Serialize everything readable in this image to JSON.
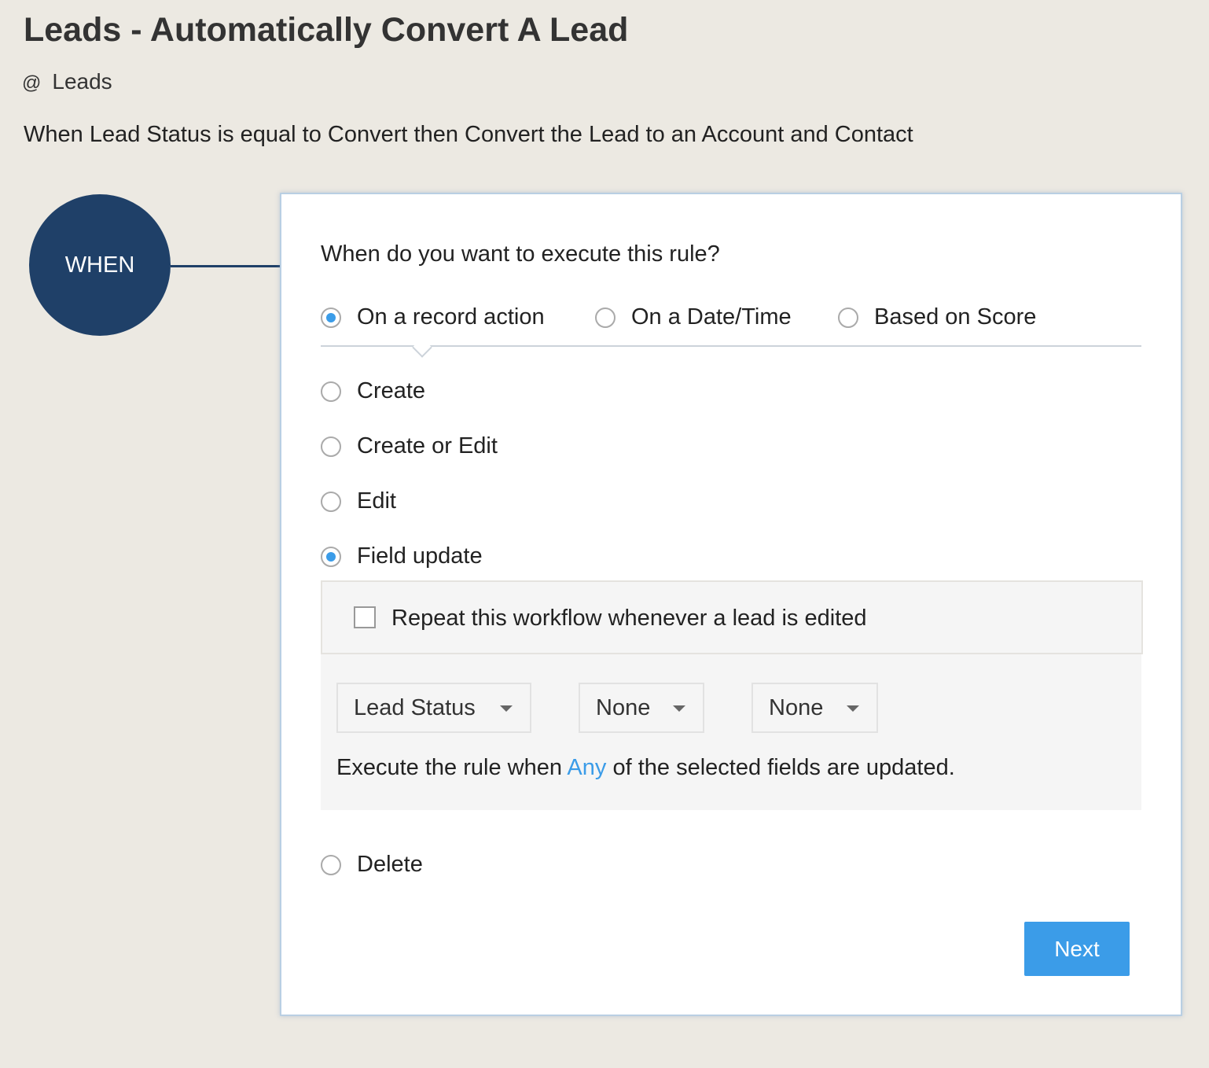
{
  "header": {
    "title": "Leads - Automatically Convert A Lead",
    "module_icon": "@",
    "module": "Leads",
    "description": "When Lead Status is equal to Convert then Convert the Lead to an Account and Contact"
  },
  "flow": {
    "step_label": "WHEN",
    "step_color": "#1f4068"
  },
  "card": {
    "question": "When do you want to execute this rule?",
    "trigger_types": [
      {
        "label": "On a record action",
        "selected": true
      },
      {
        "label": "On a Date/Time",
        "selected": false
      },
      {
        "label": "Based on Score",
        "selected": false
      }
    ],
    "actions": [
      {
        "label": "Create",
        "selected": false
      },
      {
        "label": "Create or Edit",
        "selected": false
      },
      {
        "label": "Edit",
        "selected": false
      },
      {
        "label": "Field update",
        "selected": true
      },
      {
        "label": "Delete",
        "selected": false
      }
    ],
    "repeat_label": "Repeat this workflow whenever a lead is edited",
    "repeat_checked": false,
    "field_selects": [
      "Lead Status",
      "None",
      "None"
    ],
    "exec_prefix": "Execute the rule when ",
    "exec_link": "Any",
    "exec_suffix": " of the selected fields are updated.",
    "next_label": "Next",
    "accent_color": "#3b9ce8"
  }
}
